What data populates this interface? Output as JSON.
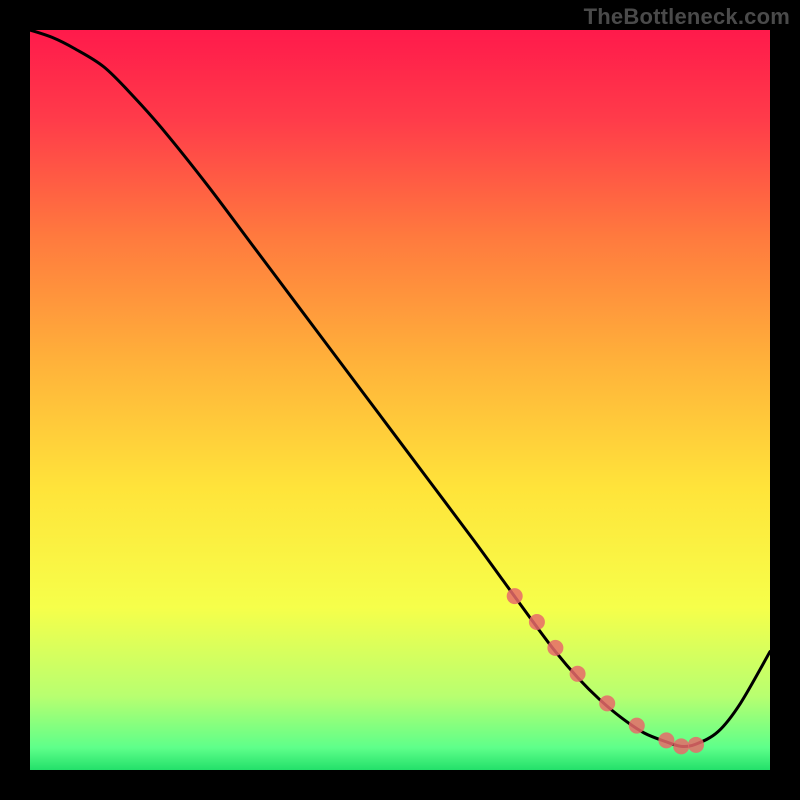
{
  "attribution": "TheBottleneck.com",
  "chart_data": {
    "type": "line",
    "title": "",
    "xlabel": "",
    "ylabel": "",
    "xlim": [
      0,
      100
    ],
    "ylim": [
      0,
      100
    ],
    "grid": false,
    "legend": false,
    "background_gradient": {
      "stops": [
        {
          "offset": 0.0,
          "color": "#ff1a4b"
        },
        {
          "offset": 0.12,
          "color": "#ff3b4a"
        },
        {
          "offset": 0.28,
          "color": "#ff7a3e"
        },
        {
          "offset": 0.45,
          "color": "#ffb23a"
        },
        {
          "offset": 0.62,
          "color": "#ffe43a"
        },
        {
          "offset": 0.78,
          "color": "#f6ff4a"
        },
        {
          "offset": 0.9,
          "color": "#b8ff70"
        },
        {
          "offset": 0.97,
          "color": "#5eff8a"
        },
        {
          "offset": 1.0,
          "color": "#23e06a"
        }
      ]
    },
    "curve": {
      "x": [
        0,
        3,
        6,
        10,
        14,
        18,
        24,
        30,
        36,
        42,
        48,
        54,
        60,
        64,
        68,
        71,
        74,
        77,
        80,
        83,
        86,
        88,
        90,
        93,
        96,
        100
      ],
      "y": [
        100,
        99,
        97.5,
        95,
        91,
        86.5,
        79,
        71,
        63,
        55,
        47,
        39,
        31,
        25.5,
        20,
        16,
        12.5,
        9.5,
        7,
        5,
        3.8,
        3.2,
        3.5,
        5.2,
        9,
        16
      ]
    },
    "markers": {
      "x": [
        65.5,
        68.5,
        71,
        74,
        78,
        82,
        86,
        88,
        90
      ],
      "y": [
        23.5,
        20,
        16.5,
        13,
        9,
        6,
        4,
        3.2,
        3.4
      ]
    }
  }
}
